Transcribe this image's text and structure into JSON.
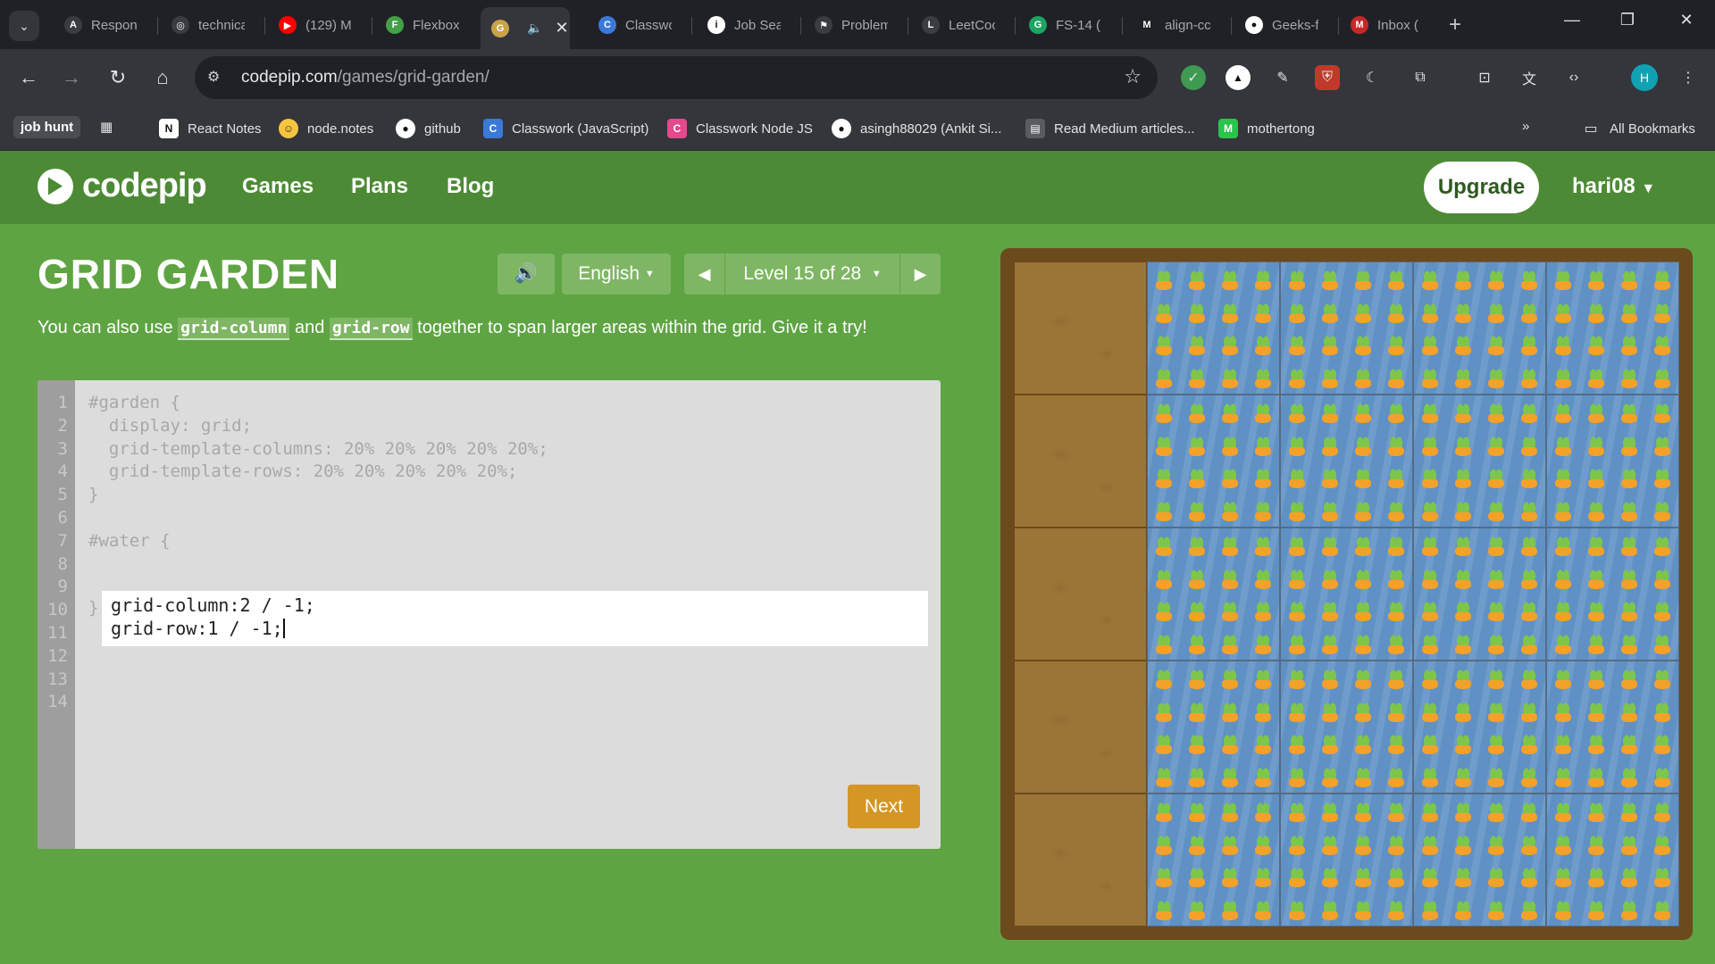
{
  "browser": {
    "tabs": [
      {
        "title": "Respon",
        "fav_color": "#3a3c41",
        "fav_text": "A"
      },
      {
        "title": "technica",
        "fav_color": "#3a3c41",
        "fav_text": "◎"
      },
      {
        "title": "(129) M",
        "fav_color": "#ff0000",
        "fav_text": "▶"
      },
      {
        "title": "Flexbox",
        "fav_color": "#43a047",
        "fav_text": "F"
      },
      {
        "title": "",
        "fav_color": "#c9a24a",
        "fav_text": "G",
        "active": true
      },
      {
        "title": "Classwo",
        "fav_color": "#3a79d8",
        "fav_text": "C"
      },
      {
        "title": "Job Sea",
        "fav_color": "#ffffff",
        "fav_text": "i"
      },
      {
        "title": "Problem",
        "fav_color": "#3a3c41",
        "fav_text": "⚑"
      },
      {
        "title": "LeetCoc",
        "fav_color": "#3a3c41",
        "fav_text": "L"
      },
      {
        "title": "FS-14 (",
        "fav_color": "#1da462",
        "fav_text": "G"
      },
      {
        "title": "align-cc",
        "fav_color": "#1f2126",
        "fav_text": "M"
      },
      {
        "title": "Geeks-f",
        "fav_color": "#ffffff",
        "fav_text": "●"
      },
      {
        "title": "Inbox (",
        "fav_color": "#c62828",
        "fav_text": "M"
      }
    ],
    "url_host": "codepip.com",
    "url_path": "/games/grid-garden/",
    "profile_initial": "H",
    "bookmarks": [
      {
        "label": "job hunt"
      },
      {
        "label": "React Notes",
        "icon_color": "#ffffff",
        "icon_text": "N"
      },
      {
        "label": "node.notes",
        "icon_color": "#f5c542",
        "icon_text": "☺"
      },
      {
        "label": "github",
        "icon_color": "#34363b",
        "icon_text": "●"
      },
      {
        "label": "Classwork (JavaScript)",
        "icon_color": "#3a79d8",
        "icon_text": "C"
      },
      {
        "label": "Classwork Node JS",
        "icon_color": "#e24a8d",
        "icon_text": "C"
      },
      {
        "label": "asingh88029 (Ankit Si...",
        "icon_color": "#34363b",
        "icon_text": "●"
      },
      {
        "label": "Read Medium articles...",
        "icon_color": "#5a5c61",
        "icon_text": "▤"
      },
      {
        "label": "mothertong",
        "icon_color": "#2bc34b",
        "icon_text": "M"
      },
      {
        "label": "All Bookmarks"
      }
    ]
  },
  "site": {
    "logo_text": "codepip",
    "nav": [
      "Games",
      "Plans",
      "Blog"
    ],
    "upgrade_label": "Upgrade",
    "username": "hari08"
  },
  "game": {
    "title": "GRID GARDEN",
    "language": "English",
    "level_label": "Level 15 of 28",
    "instructions": {
      "before": "You can also use ",
      "code1": "grid-column",
      "mid": " and ",
      "code2": "grid-row",
      "after": " together to span larger areas within the grid. Give it a try!"
    },
    "editor": {
      "line_numbers": [
        "1",
        "2",
        "3",
        "4",
        "5",
        "6",
        "7",
        "8",
        "9",
        "10",
        "11",
        "12",
        "13",
        "14"
      ],
      "code_lines": [
        "#garden {",
        "  display: grid;",
        "  grid-template-columns: 20% 20% 20% 20% 20%;",
        "  grid-template-rows: 20% 20% 20% 20% 20%;",
        "}",
        "",
        "#water {"
      ],
      "input_lines": [
        "grid-column:2 / -1;",
        "grid-row:1 / -1;"
      ],
      "closing_line": "}"
    },
    "next_label": "Next"
  },
  "colors": {
    "page_bg": "#5fa443",
    "header_bg": "#4d8a36",
    "water": "#5f91c4",
    "soil": "#9b7437",
    "next_button": "#d49625"
  }
}
